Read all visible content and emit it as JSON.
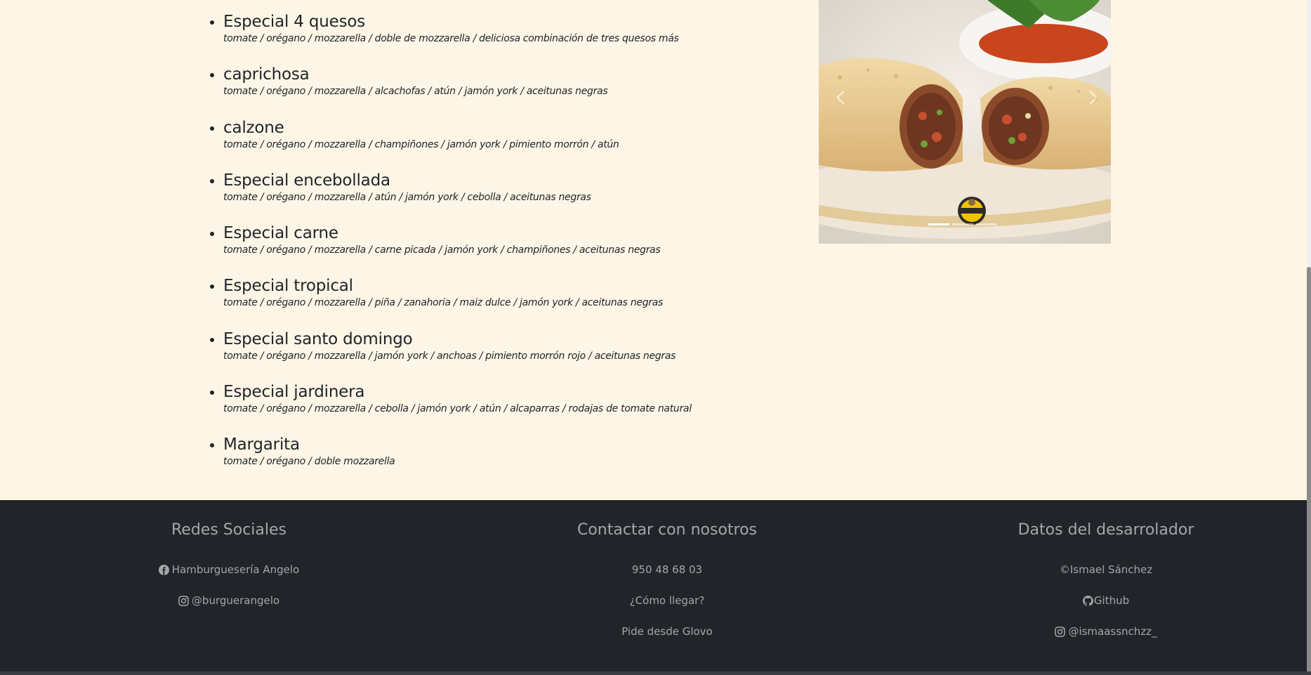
{
  "menu": [
    {
      "name": "Especial 4 quesos",
      "desc": "tomate / orégano / mozzarella / doble de mozzarella / deliciosa combinación de tres quesos más"
    },
    {
      "name": "caprichosa",
      "desc": "tomate / orégano / mozzarella / alcachofas / atún / jamón york / aceitunas negras"
    },
    {
      "name": "calzone",
      "desc": "tomate / orégano / mozzarella / champiñones / jamón york / pimiento morrón / atún"
    },
    {
      "name": "Especial encebollada",
      "desc": "tomate / orégano / mozzarella / atún / jamón york / cebolla / aceitunas negras"
    },
    {
      "name": "Especial carne",
      "desc": "tomate / orégano / mozzarella / carne picada / jamón york / champiñones / aceitunas negras"
    },
    {
      "name": "Especial tropical",
      "desc": "tomate / orégano / mozzarella / piña / zanahoria / maiz dulce / jamón york / aceitunas negras"
    },
    {
      "name": "Especial santo domingo",
      "desc": "tomate / orégano / mozzarella / jamón york / anchoas / pimiento morrón rojo / aceitunas negras"
    },
    {
      "name": "Especial jardinera",
      "desc": "tomate / orégano / mozzarella / cebolla / jamón york / atún / alcaparras / rodajas de tomate natural"
    },
    {
      "name": "Margarita",
      "desc": "tomate / orégano / doble mozzarella"
    }
  ],
  "carousel": {
    "indicator_count": 3,
    "active_index": 0
  },
  "footer": {
    "social": {
      "title": "Redes Sociales",
      "facebook": "Hamburguesería Angelo",
      "instagram": "@burguerangelo"
    },
    "contact": {
      "title": "Contactar con nosotros",
      "phone": "950 48 68 03",
      "directions": "¿Cómo llegar?",
      "glovo": "Pide desde Glovo"
    },
    "developer": {
      "title": "Datos del desarrolador",
      "name": "©Ismael Sánchez",
      "github": "Github",
      "instagram": "@ismaassnchzz_"
    }
  },
  "colors": {
    "page_bg": "#fdf5e6",
    "footer_bg": "#212529",
    "footer_text": "#a3a6aa"
  }
}
